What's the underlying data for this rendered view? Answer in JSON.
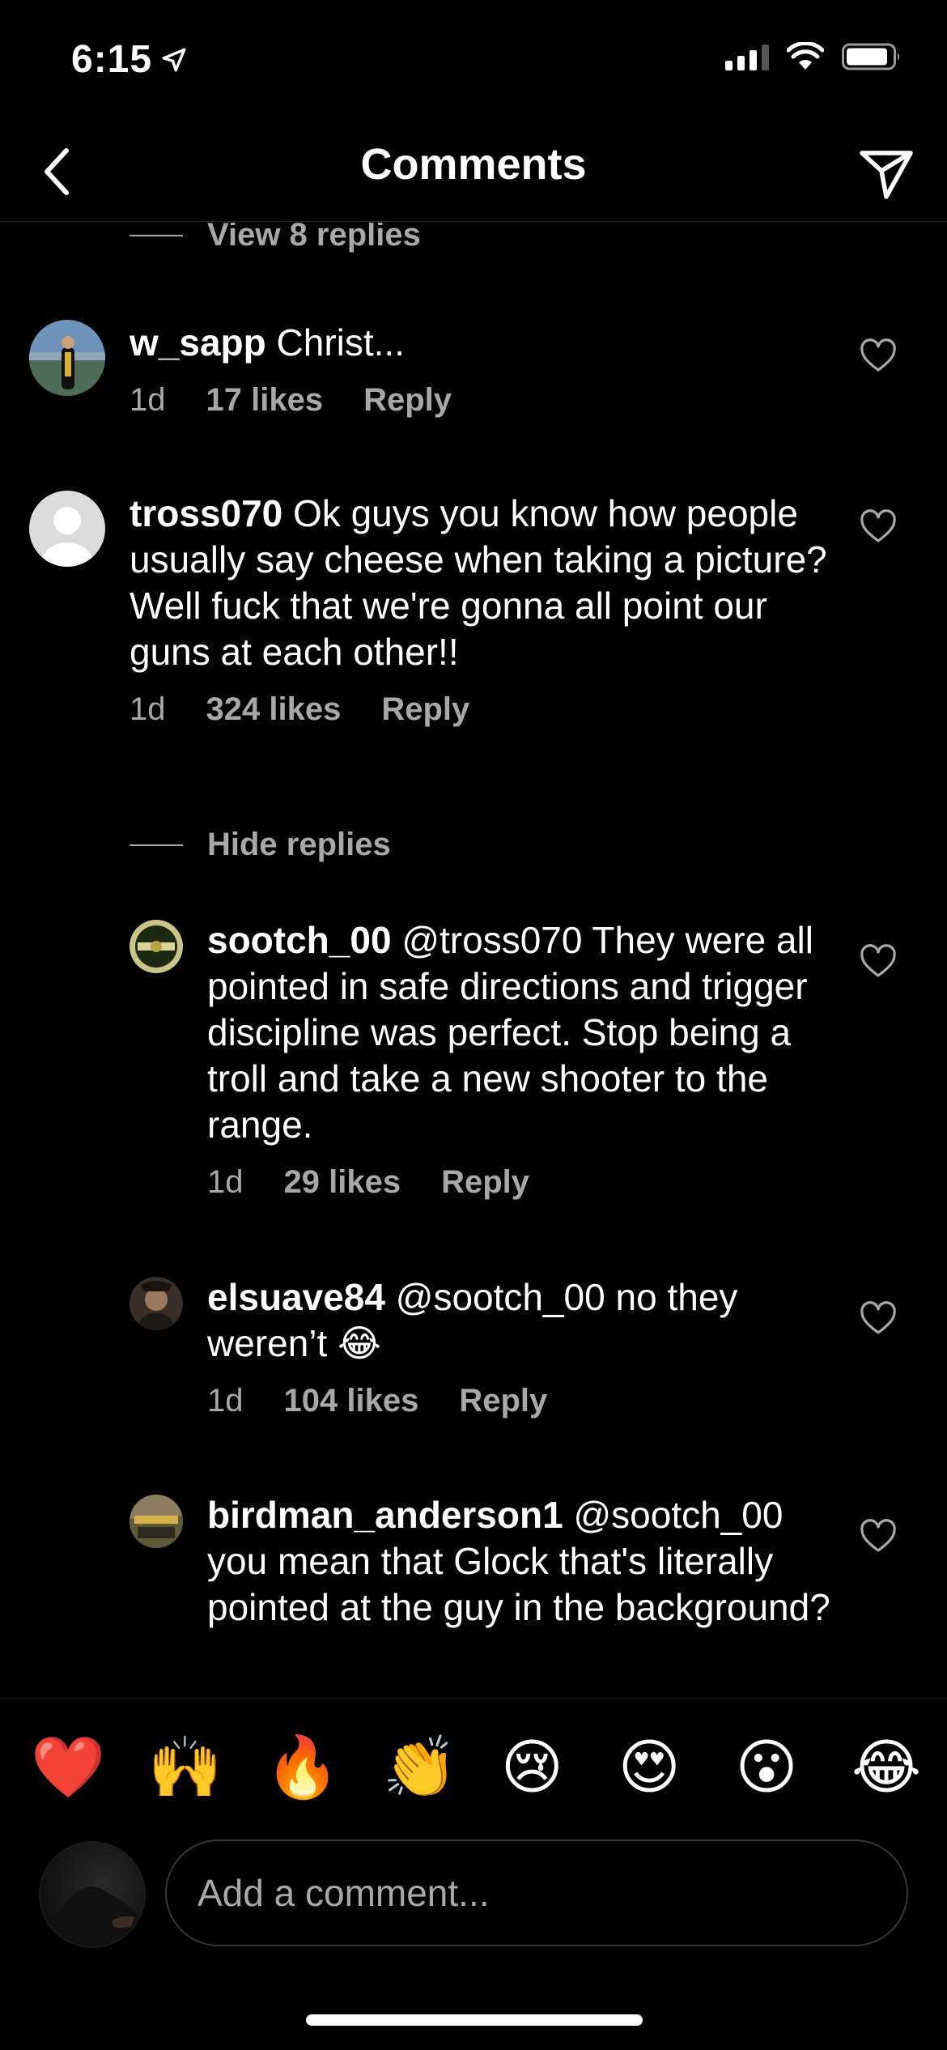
{
  "status_bar": {
    "time": "6:15",
    "icons": [
      "location-arrow-icon",
      "cellular-signal-icon",
      "wifi-icon",
      "battery-icon"
    ]
  },
  "header": {
    "title": "Comments",
    "back_icon": "chevron-left-icon",
    "share_icon": "paper-plane-icon"
  },
  "thread": {
    "top_toggle": "View 8 replies",
    "comments": [
      {
        "username": "w_sapp",
        "text": "Christ...",
        "time": "1d",
        "likes": "17 likes",
        "reply_label": "Reply"
      },
      {
        "username": "tross070",
        "text": "Ok guys you know how people usually say cheese when taking a picture? Well fuck that we're gonna all point our guns at each other!!",
        "time": "1d",
        "likes": "324 likes",
        "reply_label": "Reply",
        "replies_toggle": "Hide replies",
        "replies": [
          {
            "username": "sootch_00",
            "mention": "@tross070",
            "text": "They were all pointed in safe directions and trigger discipline was perfect. Stop being a troll and take a new shooter to the range.",
            "time": "1d",
            "likes": "29 likes",
            "reply_label": "Reply"
          },
          {
            "username": "elsuave84",
            "mention": "@sootch_00",
            "text": "no they weren’t 😂",
            "time": "1d",
            "likes": "104 likes",
            "reply_label": "Reply"
          },
          {
            "username": "birdman_anderson1",
            "mention": "@sootch_00",
            "text": "you mean that Glock that's literally pointed at the guy in the background?"
          }
        ]
      }
    ]
  },
  "emoji_bar": [
    "❤️",
    "🙌",
    "🔥",
    "👏",
    "😢",
    "😍",
    "😮",
    "😂"
  ],
  "composer": {
    "placeholder": "Add a comment..."
  },
  "colors": {
    "background": "#000000",
    "secondary_text": "#a8a8a8",
    "divider": "#262626"
  }
}
